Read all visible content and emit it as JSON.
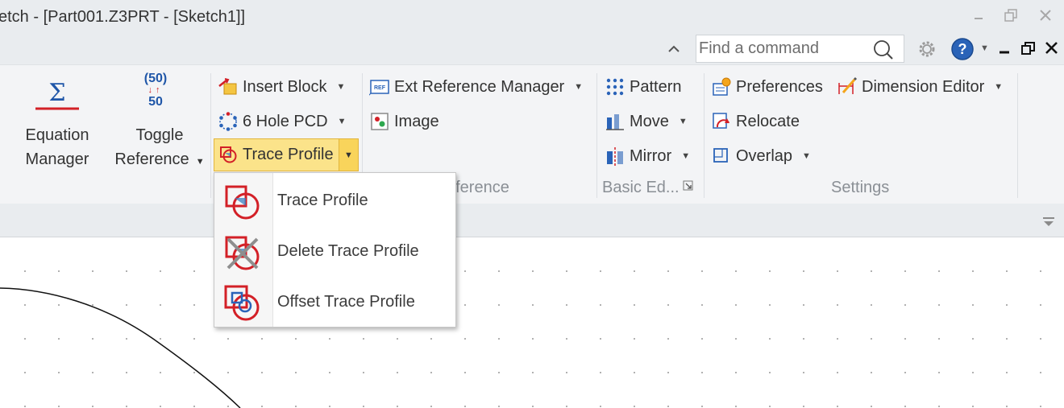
{
  "window": {
    "title": "etch - [Part001.Z3PRT - [Sketch1]]",
    "controls": [
      "minimize-icon",
      "restore-icon",
      "close-icon"
    ]
  },
  "command_bar": {
    "search_placeholder": "Find a command",
    "icons": [
      "collapse-ribbon-icon",
      "search-icon",
      "gear-icon",
      "help-icon",
      "mdi-minimize-icon",
      "mdi-restore-icon",
      "mdi-close-icon"
    ]
  },
  "ribbon": {
    "equation": {
      "line1": "Equation",
      "line2": "Manager",
      "symbol": "Σ"
    },
    "toggle": {
      "line1": "Toggle",
      "line2": "Reference",
      "badge_top": "(50)",
      "badge_bottom": "50"
    },
    "insert_group": {
      "insert_block": "Insert Block",
      "hole_pcd": "6 Hole PCD",
      "trace_profile": "Trace Profile"
    },
    "reference_group": {
      "ext_reference_manager": "Ext Reference Manager",
      "image": "Image",
      "label": "eference"
    },
    "basic_edit_group": {
      "pattern": "Pattern",
      "move": "Move",
      "mirror": "Mirror",
      "label": "Basic Ed..."
    },
    "settings_group": {
      "preferences": "Preferences",
      "dimension_editor": "Dimension Editor",
      "relocate": "Relocate",
      "overlap": "Overlap",
      "label": "Settings"
    }
  },
  "trace_menu": {
    "items": [
      {
        "label": "Trace Profile",
        "icon": "trace-profile-icon"
      },
      {
        "label": "Delete Trace Profile",
        "icon": "delete-trace-profile-icon"
      },
      {
        "label": "Offset Trace Profile",
        "icon": "offset-trace-profile-icon"
      }
    ]
  },
  "colors": {
    "accent_red": "#d32027",
    "accent_blue": "#1f6fb6",
    "highlight": "#fbe38a",
    "ribbon_bg": "#f3f4f6",
    "chrome_bg": "#e9ecef"
  }
}
